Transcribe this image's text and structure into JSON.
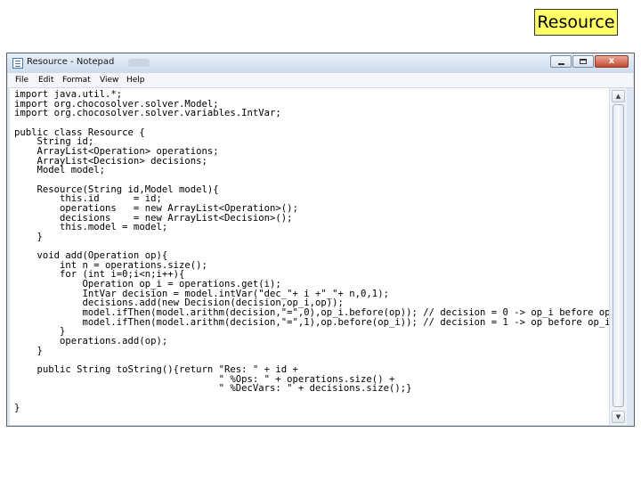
{
  "slide": {
    "title": "Resource"
  },
  "window": {
    "title": "Resource - Notepad",
    "controls": {
      "close_glyph": "x"
    }
  },
  "menu": [
    "File",
    "Edit",
    "Format",
    "View",
    "Help"
  ],
  "editor": {
    "content": "import java.util.*;\nimport org.chocosolver.solver.Model;\nimport org.chocosolver.solver.variables.IntVar;\n\npublic class Resource {\n    String id;\n    ArrayList<Operation> operations;\n    ArrayList<Decision> decisions;\n    Model model;\n\n    Resource(String id,Model model){\n        this.id      = id;\n        operations   = new ArrayList<Operation>();\n        decisions    = new ArrayList<Decision>();\n        this.model = model;\n    }\n\n    void add(Operation op){\n        int n = operations.size();\n        for (int i=0;i<n;i++){\n            Operation op_i = operations.get(i);\n            IntVar decision = model.intVar(\"dec_\"+ i +\"_\"+ n,0,1);\n            decisions.add(new Decision(decision,op_i,op));\n            model.ifThen(model.arithm(decision,\"=\",0),op_i.before(op)); // decision = 0 -> op_i before op\n            model.ifThen(model.arithm(decision,\"=\",1),op.before(op_i)); // decision = 1 -> op before op_i\n        }\n        operations.add(op);\n    }\n\n    public String toString(){return \"Res: \" + id +\n                                    \" %Ops: \" + operations.size() +\n                                    \" %DecVars: \" + decisions.size();}\n\n}"
  },
  "icons": {
    "app": "notepad-icon",
    "minimize": "minimize-icon",
    "maximize": "maximize-icon",
    "close": "close-icon",
    "scroll_up": "arrow-up-icon",
    "scroll_down": "arrow-down-icon"
  }
}
